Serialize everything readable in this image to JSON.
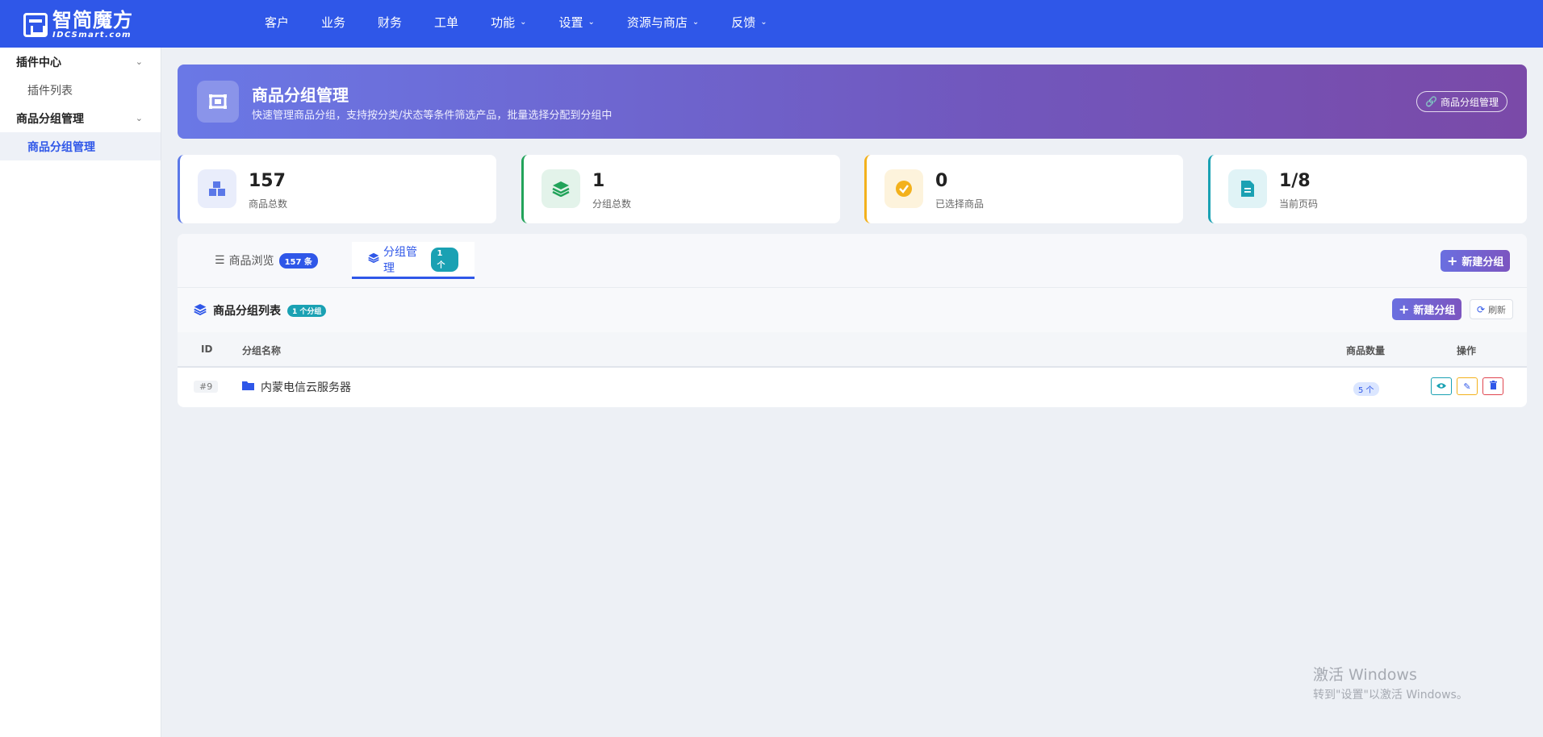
{
  "brand": {
    "name_cn": "智简魔方",
    "name_en": "IDCSmart.com"
  },
  "nav": [
    {
      "label": "客户",
      "has_dropdown": false
    },
    {
      "label": "业务",
      "has_dropdown": false
    },
    {
      "label": "财务",
      "has_dropdown": false
    },
    {
      "label": "工单",
      "has_dropdown": false
    },
    {
      "label": "功能",
      "has_dropdown": true
    },
    {
      "label": "设置",
      "has_dropdown": true
    },
    {
      "label": "资源与商店",
      "has_dropdown": true
    },
    {
      "label": "反馈",
      "has_dropdown": true
    }
  ],
  "sidebar": {
    "groups": [
      {
        "label": "插件中心",
        "items": [
          {
            "label": "插件列表",
            "active": false
          }
        ]
      },
      {
        "label": "商品分组管理",
        "items": [
          {
            "label": "商品分组管理",
            "active": true
          }
        ]
      }
    ]
  },
  "hero": {
    "title": "商品分组管理",
    "subtitle": "快速管理商品分组，支持按分类/状态等条件筛选产品，批量选择分配到分组中",
    "link_label": "商品分组管理"
  },
  "stats": [
    {
      "value": "157",
      "label": "商品总数",
      "icon": "boxes-icon",
      "accent": "#5b78e8"
    },
    {
      "value": "1",
      "label": "分组总数",
      "icon": "layers-icon",
      "accent": "#22a35a"
    },
    {
      "value": "0",
      "label": "已选择商品",
      "icon": "check-circle-icon",
      "accent": "#f3b11c"
    },
    {
      "value": "1/8",
      "label": "当前页码",
      "icon": "file-icon",
      "accent": "#1aa1b3"
    }
  ],
  "tabs": [
    {
      "label": "商品浏览",
      "badge": "157 条",
      "active": false
    },
    {
      "label": "分组管理",
      "badge": "1 个",
      "active": true
    }
  ],
  "toolbar": {
    "new_group_label": "新建分组"
  },
  "group_list": {
    "title": "商品分组列表",
    "badge": "1 个分组",
    "new_group_label": "新建分组",
    "refresh_label": "刷新",
    "columns": {
      "id": "ID",
      "name": "分组名称",
      "count": "商品数量",
      "actions": "操作"
    },
    "rows": [
      {
        "id": "#9",
        "name": "内蒙电信云服务器",
        "count": "5 个"
      }
    ]
  },
  "watermark": {
    "line1": "激活 Windows",
    "line2": "转到\"设置\"以激活 Windows。"
  },
  "colors": {
    "primary": "#2f57e8",
    "success": "#22a35a",
    "warning": "#f3b11c",
    "info": "#1aa1b3",
    "danger": "#e0454f"
  }
}
